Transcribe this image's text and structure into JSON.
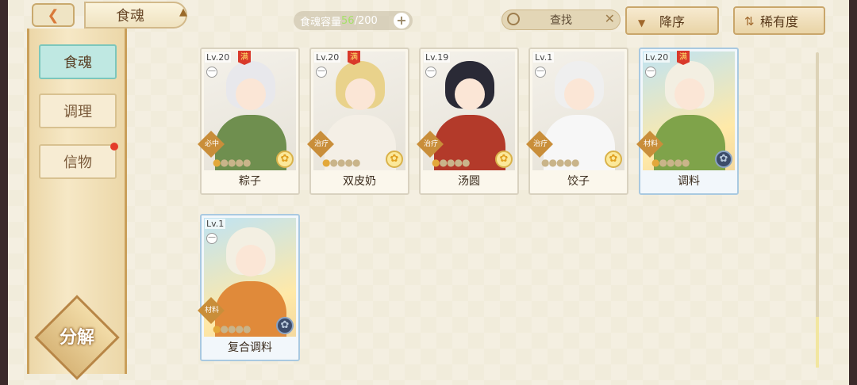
{
  "header": {
    "title": "食魂",
    "capacity_label": "食魂容量",
    "capacity_current": "56",
    "capacity_sep": "/",
    "capacity_max": "200",
    "search_label": "查找",
    "sort_label": "降序",
    "rarity_label": "稀有度"
  },
  "sidebar": {
    "items": [
      {
        "label": "食魂",
        "active": true
      },
      {
        "label": "调理",
        "active": false
      },
      {
        "label": "信物",
        "active": false,
        "notification": true
      }
    ],
    "decompose_label": "分解"
  },
  "cards": [
    {
      "name": "粽子",
      "level": "Lv.20",
      "max": "满",
      "role": "必中",
      "gold_bells": 1,
      "bells": 5,
      "rarity": "normal",
      "hair": "#e8e8ec",
      "outfit": "#6f8f4f",
      "flower": "gold"
    },
    {
      "name": "双皮奶",
      "level": "Lv.20",
      "max": "满",
      "role": "治疗",
      "gold_bells": 1,
      "bells": 5,
      "rarity": "normal",
      "hair": "#e9d28b",
      "outfit": "#f4efe6",
      "flower": "gold"
    },
    {
      "name": "汤圆",
      "level": "Lv.19",
      "max": "",
      "role": "治疗",
      "gold_bells": 1,
      "bells": 5,
      "rarity": "normal",
      "hair": "#2a2a36",
      "outfit": "#b33a2a",
      "flower": "gold"
    },
    {
      "name": "饺子",
      "level": "Lv.1",
      "max": "",
      "role": "治疗",
      "gold_bells": 0,
      "bells": 5,
      "rarity": "normal",
      "hair": "#efefef",
      "outfit": "#f7f7f7",
      "flower": "gold"
    },
    {
      "name": "调料",
      "level": "Lv.20",
      "max": "满",
      "role": "材料",
      "gold_bells": 1,
      "bells": 5,
      "rarity": "epic",
      "hair": "#f3efe2",
      "outfit": "#7fa34a",
      "flower": "dark"
    },
    {
      "name": "复合调料",
      "level": "Lv.1",
      "max": "",
      "role": "材料",
      "gold_bells": 1,
      "bells": 5,
      "rarity": "epic",
      "hair": "#f3efe2",
      "outfit": "#e08a3a",
      "flower": "dark"
    }
  ]
}
